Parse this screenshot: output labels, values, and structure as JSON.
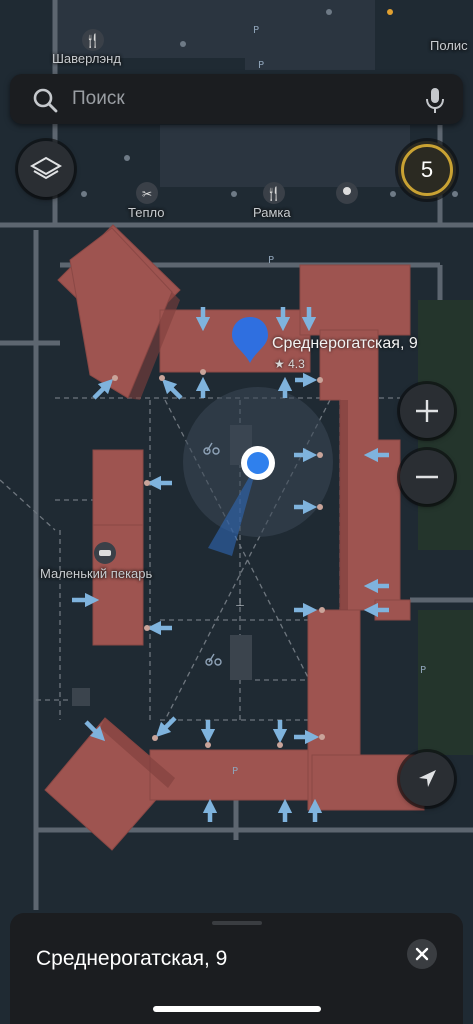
{
  "search": {
    "placeholder": "Поиск"
  },
  "traffic_level": "5",
  "map_labels": {
    "shaverlend": "Шаверлэнд",
    "polis": "Полис",
    "teplo": "Тепло",
    "ramka": "Рамка",
    "bakery": "Маленький пекарь"
  },
  "poi": {
    "name": "Среднерогатская, 9",
    "rating": "★ 4.3"
  },
  "sheet": {
    "title": "Среднерогатская, 9"
  },
  "icons": [
    "search-icon",
    "mic-icon",
    "layers-icon",
    "zoom-in-icon",
    "zoom-out-icon",
    "locate-arrow-icon",
    "close-icon",
    "pin-icon",
    "user-location-icon"
  ],
  "colors": {
    "building": "#9e5450",
    "accent": "#3b82f6",
    "traffic": "#c9a233",
    "arrow": "#7fb3dd"
  }
}
